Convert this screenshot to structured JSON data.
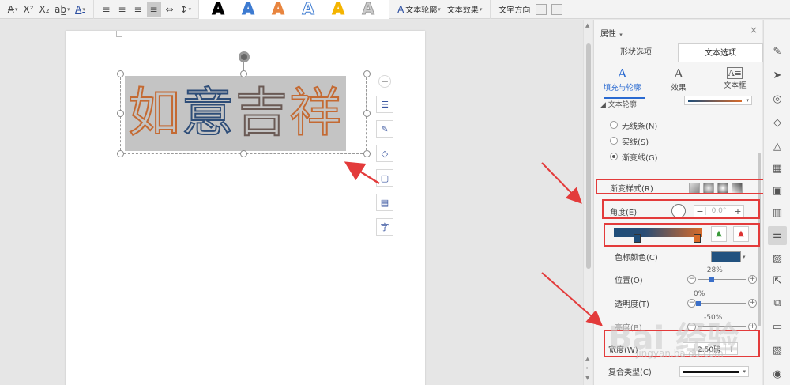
{
  "toolbar": {
    "sample_glyph": "A",
    "text_outline": "文本轮廓",
    "text_effect": "文本效果",
    "text_direction": "文字方向",
    "samples": [
      {
        "fill": "#000000",
        "stroke": "#000000"
      },
      {
        "fill": "#3d7bd1",
        "stroke": "#3d7bd1"
      },
      {
        "fill": "#e8853f",
        "stroke": "#e8853f"
      },
      {
        "fill": "#ffffff",
        "stroke": "#3d7bd1"
      },
      {
        "fill": "#f4b400",
        "stroke": "#f4b400"
      },
      {
        "fill": "#cccccc",
        "stroke": "#999999"
      }
    ]
  },
  "canvas": {
    "wordart_chars": [
      "如",
      "意",
      "吉",
      "祥"
    ]
  },
  "panel": {
    "title": "属性",
    "tabs": [
      "形状选项",
      "文本选项"
    ],
    "active_tab": 1,
    "subtabs": [
      {
        "label": "填充与轮廓",
        "icon": "A"
      },
      {
        "label": "效果",
        "icon": "A"
      },
      {
        "label": "文本框",
        "icon": "A≡"
      }
    ],
    "section_label": "◢ 文本轮廓",
    "line_options": [
      "无线条(N)",
      "实线(S)",
      "渐变线(G)"
    ],
    "selected_line": 2,
    "gradient_style_label": "渐变样式(R)",
    "angle_label": "角度(E)",
    "angle_value": "0.0°",
    "stop_color_label": "色标颜色(C)",
    "stop_color": "#22527f",
    "position_label": "位置(O)",
    "position_value": "28%",
    "position_fraction": 0.28,
    "transparency_label": "透明度(T)",
    "transparency_value": "0%",
    "transparency_fraction": 0.0,
    "brightness_label": "亮度(B)",
    "brightness_value": "-50%",
    "width_label": "宽度(W)",
    "width_value": "2.50磅",
    "compound_label": "复合类型(C)"
  },
  "watermark": {
    "main": "Bai 经验",
    "sub": "jingyan.baidu.com"
  }
}
